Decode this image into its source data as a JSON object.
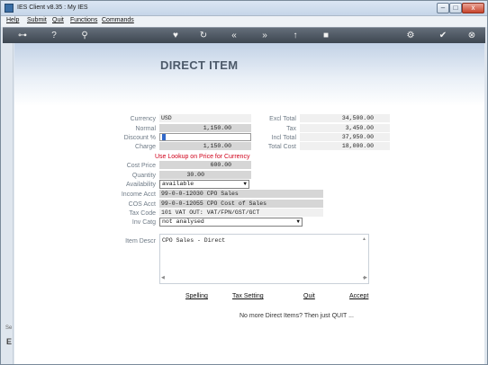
{
  "window": {
    "title": "IES Client v8.35 : My IES",
    "min_label": "–",
    "max_label": "□",
    "close_label": "x"
  },
  "menu": {
    "help": "Help",
    "submit": "Submit",
    "quit": "Quit",
    "functions": "Functions",
    "commands": "Commands"
  },
  "toolbar_icons": [
    "key-icon",
    "help-icon",
    "search-icon",
    "heart-icon",
    "refresh-icon",
    "rewind-icon",
    "forward-icon",
    "cursor-icon",
    "stop-icon",
    "settings-icon",
    "ok-icon",
    "close-icon"
  ],
  "leftbar": {
    "text": "Se",
    "mark": "E"
  },
  "page": {
    "title": "DIRECT ITEM",
    "labels": {
      "currency": "Currency",
      "normal": "Normal",
      "discount": "Discount %",
      "charge": "Charge",
      "cost_price": "Cost Price",
      "quantity": "Quantity",
      "availability": "Availability",
      "income_acct": "Income Acct",
      "cos_acct": "COS Acct",
      "tax_code": "Tax Code",
      "inv_catg": "Inv Catg",
      "item_descr": "Item Descr",
      "excl_total": "Excl Total",
      "tax": "Tax",
      "incl_total": "Incl Total",
      "total_cost": "Total Cost"
    },
    "values": {
      "currency": "USD",
      "normal": "1,150.00",
      "discount": "",
      "charge": "1,150.00",
      "cost_price": "600.00",
      "quantity": "30.00",
      "availability": "available",
      "income_acct": "99-0-0-12030 CPO Sales",
      "cos_acct": "99-0-0-12055 CPO Cost of Sales",
      "tax_code": "101 VAT OUT: VAT/FPN/GST/GCT",
      "inv_catg": "not analysed",
      "item_descr": "CPO Sales - Direct",
      "excl_total": "34,500.00",
      "tax": "3,450.00",
      "incl_total": "37,950.00",
      "total_cost": "18,000.00"
    },
    "warning": "Use Lookup on Price for Currency",
    "actions": {
      "spelling": "Spelling",
      "tax_setting": "Tax Setting",
      "quit": "Quit",
      "accept": "Accept"
    },
    "footer_message": "No more Direct Items? Then just QUIT ..."
  }
}
